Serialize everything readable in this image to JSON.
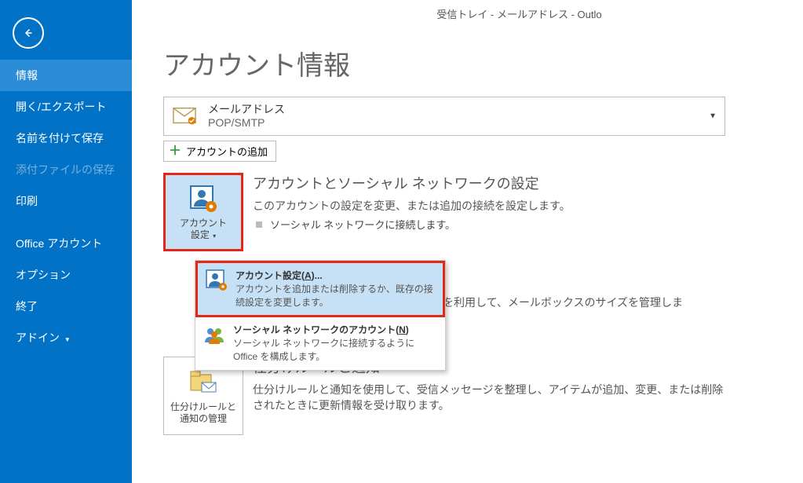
{
  "title_bar": "受信トレイ - メールアドレス - Outlo",
  "sidebar": {
    "items": [
      {
        "label": "情報",
        "active": true
      },
      {
        "label": "開く/エクスポート"
      },
      {
        "label": "名前を付けて保存"
      },
      {
        "label": "添付ファイルの保存",
        "disabled": true
      },
      {
        "label": "印刷"
      }
    ],
    "items2": [
      {
        "label": "Office アカウント"
      },
      {
        "label": "オプション"
      },
      {
        "label": "終了"
      },
      {
        "label": "アドイン",
        "caret": true
      }
    ]
  },
  "page": {
    "title": "アカウント情報",
    "account": {
      "address": "メールアドレス",
      "protocol": "POP/SMTP"
    },
    "add_account_label": "アカウントの追加",
    "sections": {
      "account_settings": {
        "tile_label": "アカウント\n設定",
        "heading": "アカウントとソーシャル ネットワークの設定",
        "desc": "このアカウントの設定を変更、または追加の接続を設定します。",
        "bullet": "ソーシャル ネットワークに接続します。"
      },
      "cleanup_fragment": "や整理を利用して、メールボックスのサイズを管理しま",
      "rules": {
        "tile_label": "仕分けルールと\n通知の管理",
        "heading": "仕分けルールと通知",
        "desc": "仕分けルールと通知を使用して、受信メッセージを整理し、アイテムが追加、変更、または削除されたときに更新情報を受け取ります。"
      }
    },
    "dropdown": {
      "item1": {
        "title_pre": "アカウント設定(",
        "title_mn": "A",
        "title_post": ")...",
        "sub": "アカウントを追加または削除するか、既存の接続設定を変更します。"
      },
      "item2": {
        "title_pre": "ソーシャル ネットワークのアカウント(",
        "title_mn": "N",
        "title_post": ")",
        "sub": "ソーシャル ネットワークに接続するように Office を構成します。"
      }
    }
  }
}
